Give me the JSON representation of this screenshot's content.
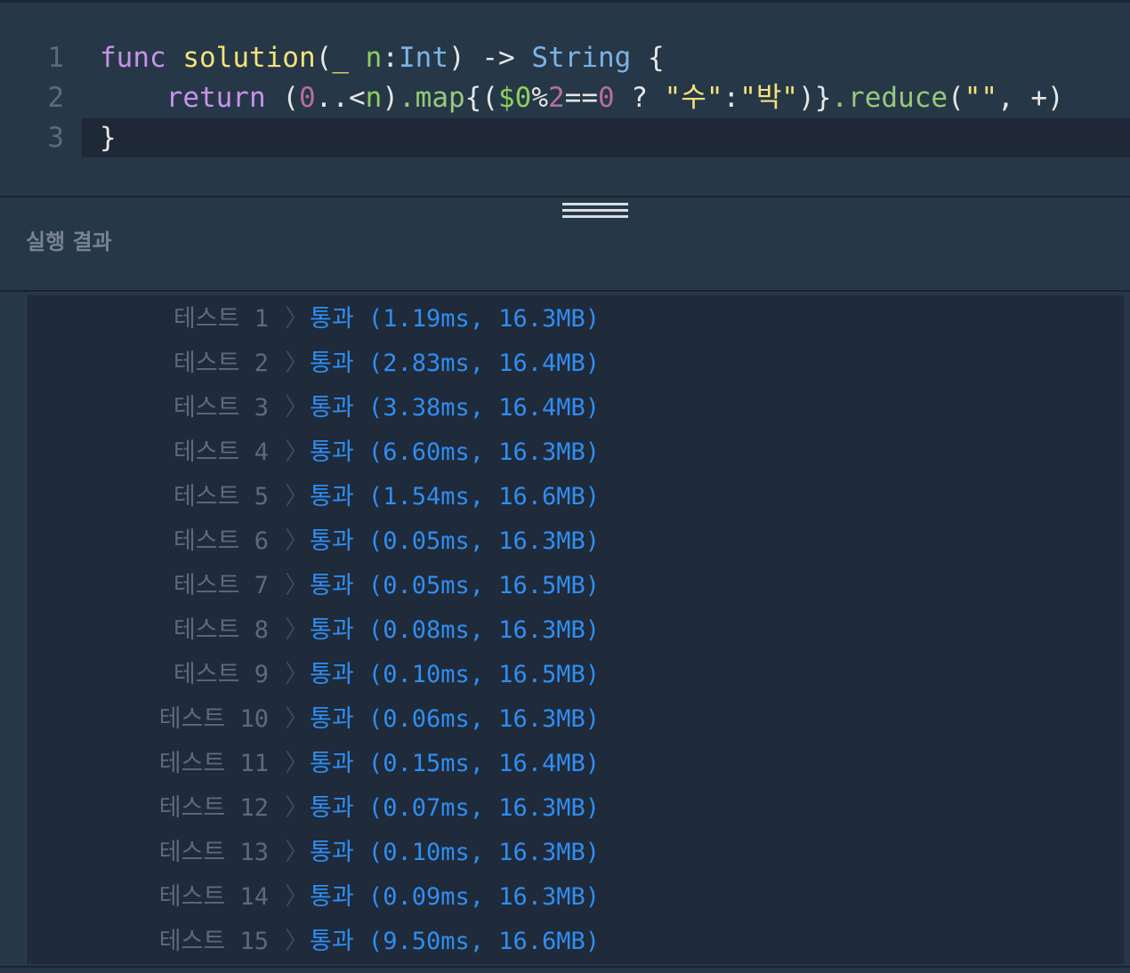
{
  "editor": {
    "lines": [
      {
        "num": "1"
      },
      {
        "num": "2"
      },
      {
        "num": "3"
      }
    ],
    "line1": {
      "func": "func",
      "name": "solution",
      "open": "(",
      "underscore": "_",
      "param": "n",
      "colon": ":",
      "type": "Int",
      "close": ")",
      "arrow": "->",
      "ret": "String",
      "brace": "{"
    },
    "line2": {
      "ret": "return",
      "p1": "(",
      "zero": "0",
      "range": "..<",
      "n": "n",
      "p2": ")",
      "map": ".map",
      "b1": "{(",
      "dollar": "$0",
      "mod": "%",
      "two": "2",
      "eq": "==",
      "zero2": "0",
      "q": "?",
      "s1": "\"수\"",
      "colon": ":",
      "s2": "\"박\"",
      "b2": ")}",
      "reduce": ".reduce",
      "p3": "(",
      "s3": "\"\"",
      "comma": ",",
      "plus": "+)"
    },
    "line3": {
      "brace": "}"
    }
  },
  "panel": {
    "title": "실행 결과"
  },
  "results": [
    {
      "label": "테스트 1",
      "status": "통과 (1.19ms, 16.3MB)"
    },
    {
      "label": "테스트 2",
      "status": "통과 (2.83ms, 16.4MB)"
    },
    {
      "label": "테스트 3",
      "status": "통과 (3.38ms, 16.4MB)"
    },
    {
      "label": "테스트 4",
      "status": "통과 (6.60ms, 16.3MB)"
    },
    {
      "label": "테스트 5",
      "status": "통과 (1.54ms, 16.6MB)"
    },
    {
      "label": "테스트 6",
      "status": "통과 (0.05ms, 16.3MB)"
    },
    {
      "label": "테스트 7",
      "status": "통과 (0.05ms, 16.5MB)"
    },
    {
      "label": "테스트 8",
      "status": "통과 (0.08ms, 16.3MB)"
    },
    {
      "label": "테스트 9",
      "status": "통과 (0.10ms, 16.5MB)"
    },
    {
      "label": "테스트 10",
      "status": "통과 (0.06ms, 16.3MB)"
    },
    {
      "label": "테스트 11",
      "status": "통과 (0.15ms, 16.4MB)"
    },
    {
      "label": "테스트 12",
      "status": "통과 (0.07ms, 16.3MB)"
    },
    {
      "label": "테스트 13",
      "status": "통과 (0.10ms, 16.3MB)"
    },
    {
      "label": "테스트 14",
      "status": "통과 (0.09ms, 16.3MB)"
    },
    {
      "label": "테스트 15",
      "status": "통과 (9.50ms, 16.6MB)"
    }
  ],
  "colors": {
    "background": "#263747",
    "results_background": "#1f2a3a",
    "pass": "#2f8ef2",
    "label": "#5b6b7c"
  },
  "icons": {
    "chevron": "chevron-right-icon",
    "resize_handle": "resize-handle-icon"
  }
}
